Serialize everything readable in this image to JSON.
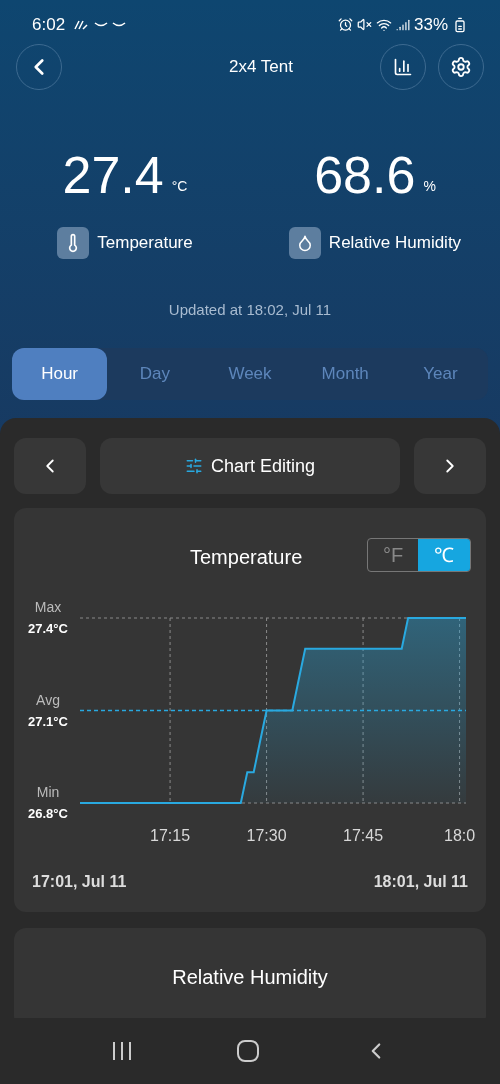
{
  "status_bar": {
    "time": "6:02",
    "battery": "33%"
  },
  "header": {
    "title": "2x4 Tent"
  },
  "readings": [
    {
      "kind": "temperature",
      "value": "27.4",
      "unit": "°C",
      "label": "Temperature"
    },
    {
      "kind": "humidity",
      "value": "68.6",
      "unit": "%",
      "label": "Relative Humidity"
    }
  ],
  "updated": "Updated at 18:02, Jul 11",
  "tabs": [
    {
      "label": "Hour",
      "selected": true
    },
    {
      "label": "Day",
      "selected": false
    },
    {
      "label": "Week",
      "selected": false
    },
    {
      "label": "Month",
      "selected": false
    },
    {
      "label": "Year",
      "selected": false
    }
  ],
  "chart_nav": {
    "label": "Chart Editing"
  },
  "temperature_card": {
    "units": [
      {
        "label": "°F",
        "selected": false
      },
      {
        "label": "℃",
        "selected": true
      }
    ],
    "y_tick_captions": [
      "Max",
      "Avg",
      "Min"
    ],
    "chart_data": {
      "type": "area",
      "title": "Temperature",
      "grid": true,
      "ylim": [
        26.8,
        27.4
      ],
      "categories": [
        null,
        null,
        null,
        null,
        null,
        null,
        null,
        null,
        null,
        null,
        null,
        null,
        null,
        null,
        "17:15",
        null,
        null,
        null,
        null,
        null,
        null,
        null,
        null,
        null,
        null,
        null,
        null,
        null,
        null,
        "17:30",
        null,
        null,
        null,
        null,
        null,
        null,
        null,
        null,
        null,
        null,
        null,
        null,
        null,
        null,
        "17:45",
        null,
        null,
        null,
        null,
        null,
        null,
        null,
        null,
        null,
        null,
        null,
        null,
        null,
        null,
        "18:0",
        null
      ],
      "yticks": [
        {
          "value": 27.4,
          "label": "27.4°C"
        },
        {
          "value": 27.1,
          "label": "27.1°C"
        },
        {
          "value": 26.8,
          "label": "26.8°C"
        }
      ],
      "ref_lines": [
        {
          "axis": "y",
          "value": 27.1
        }
      ],
      "series": [
        {
          "color": "#29a9e0",
          "values": [
            26.8,
            26.8,
            26.8,
            26.8,
            26.8,
            26.8,
            26.8,
            26.8,
            26.8,
            26.8,
            26.8,
            26.8,
            26.8,
            26.8,
            26.8,
            26.8,
            26.8,
            26.8,
            26.8,
            26.8,
            26.8,
            26.8,
            26.8,
            26.8,
            26.8,
            26.8,
            26.9,
            26.9,
            27.0,
            27.1,
            27.1,
            27.1,
            27.1,
            27.1,
            27.2,
            27.3,
            27.3,
            27.3,
            27.3,
            27.3,
            27.3,
            27.3,
            27.3,
            27.3,
            27.3,
            27.3,
            27.3,
            27.3,
            27.3,
            27.3,
            27.3,
            27.4,
            27.4,
            27.4,
            27.4,
            27.4,
            27.4,
            27.4,
            27.4,
            27.4,
            27.4
          ]
        }
      ]
    },
    "range_start": "17:01, Jul 11",
    "range_end": "18:01, Jul 11"
  },
  "humidity_card": {
    "title": "Relative Humidity"
  }
}
